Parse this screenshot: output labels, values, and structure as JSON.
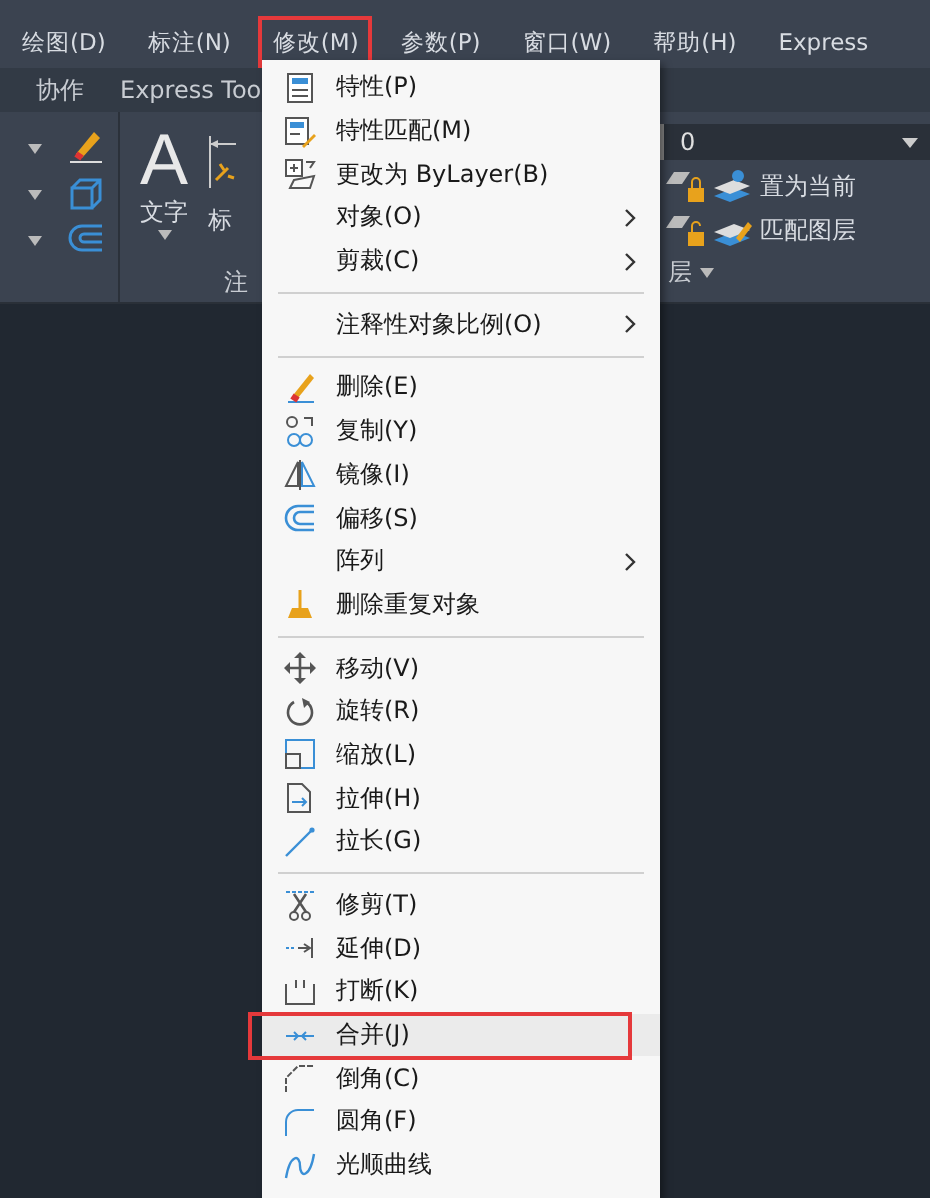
{
  "menubar": [
    {
      "label": "绘图(D)",
      "highlighted": false
    },
    {
      "label": "标注(N)",
      "highlighted": false
    },
    {
      "label": "修改(M)",
      "highlighted": true
    },
    {
      "label": "参数(P)",
      "highlighted": false
    },
    {
      "label": "窗口(W)",
      "highlighted": false
    },
    {
      "label": "帮助(H)",
      "highlighted": false
    },
    {
      "label": "Express",
      "highlighted": false
    }
  ],
  "ribbon_tabs": [
    {
      "label": "协作"
    },
    {
      "label": "Express Too"
    }
  ],
  "ribbon": {
    "text_glyph": "A",
    "text_label": "文字",
    "dim_label": "标",
    "left_panel_title": "注",
    "layer_value": "0",
    "layer_buttons": [
      "置为当前",
      "匹配图层"
    ],
    "right_panel_title": "层"
  },
  "menu": [
    {
      "kind": "item",
      "label": "特性(P)",
      "submenu": false,
      "highlighted": false
    },
    {
      "kind": "item",
      "label": "特性匹配(M)",
      "submenu": false,
      "highlighted": false
    },
    {
      "kind": "item",
      "label": "更改为 ByLayer(B)",
      "submenu": false,
      "highlighted": false
    },
    {
      "kind": "item",
      "label": "对象(O)",
      "submenu": true,
      "highlighted": false
    },
    {
      "kind": "item",
      "label": "剪裁(C)",
      "submenu": true,
      "highlighted": false
    },
    {
      "kind": "separator"
    },
    {
      "kind": "item",
      "label": "注释性对象比例(O)",
      "submenu": true,
      "highlighted": false
    },
    {
      "kind": "separator"
    },
    {
      "kind": "item",
      "label": "删除(E)",
      "submenu": false,
      "highlighted": false
    },
    {
      "kind": "item",
      "label": "复制(Y)",
      "submenu": false,
      "highlighted": false
    },
    {
      "kind": "item",
      "label": "镜像(I)",
      "submenu": false,
      "highlighted": false
    },
    {
      "kind": "item",
      "label": "偏移(S)",
      "submenu": false,
      "highlighted": false
    },
    {
      "kind": "item",
      "label": "阵列",
      "submenu": true,
      "highlighted": false
    },
    {
      "kind": "item",
      "label": "删除重复对象",
      "submenu": false,
      "highlighted": false
    },
    {
      "kind": "separator"
    },
    {
      "kind": "item",
      "label": "移动(V)",
      "submenu": false,
      "highlighted": false
    },
    {
      "kind": "item",
      "label": "旋转(R)",
      "submenu": false,
      "highlighted": false
    },
    {
      "kind": "item",
      "label": "缩放(L)",
      "submenu": false,
      "highlighted": false
    },
    {
      "kind": "item",
      "label": "拉伸(H)",
      "submenu": false,
      "highlighted": false
    },
    {
      "kind": "item",
      "label": "拉长(G)",
      "submenu": false,
      "highlighted": false
    },
    {
      "kind": "separator"
    },
    {
      "kind": "item",
      "label": "修剪(T)",
      "submenu": false,
      "highlighted": false
    },
    {
      "kind": "item",
      "label": "延伸(D)",
      "submenu": false,
      "highlighted": false
    },
    {
      "kind": "item",
      "label": "打断(K)",
      "submenu": false,
      "highlighted": false
    },
    {
      "kind": "item",
      "label": "合并(J)",
      "submenu": false,
      "highlighted": true
    },
    {
      "kind": "item",
      "label": "倒角(C)",
      "submenu": false,
      "highlighted": false
    },
    {
      "kind": "item",
      "label": "圆角(F)",
      "submenu": false,
      "highlighted": false
    },
    {
      "kind": "item",
      "label": "光顺曲线",
      "submenu": false,
      "highlighted": false
    }
  ]
}
